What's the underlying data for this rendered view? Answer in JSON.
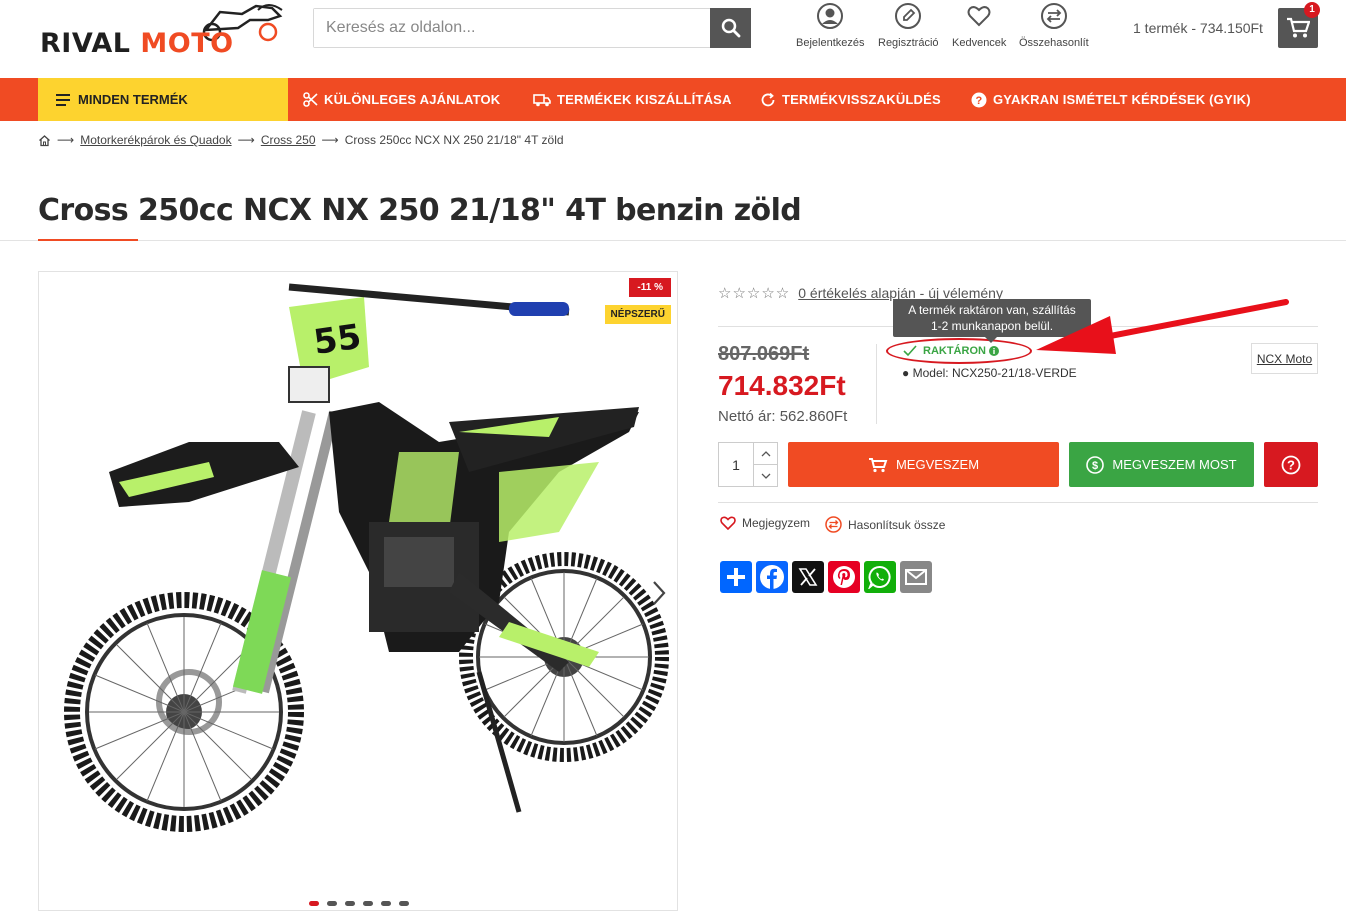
{
  "header": {
    "logo_rival": "RIVAL",
    "logo_moto": "MOTO",
    "search_placeholder": "Keresés az oldalon...",
    "icons": [
      {
        "name": "user-icon",
        "label": "Bejelentkezés"
      },
      {
        "name": "pencil-icon",
        "label": "Regisztráció"
      },
      {
        "name": "heart-icon",
        "label": "Kedvencek"
      },
      {
        "name": "compare-icon",
        "label": "Összehasonlít"
      }
    ],
    "cart_text": "1 termék - 734.150Ft",
    "cart_count": "1"
  },
  "nav": {
    "all_products": "MINDEN TERMÉK",
    "items": [
      "KÜLÖNLEGES AJÁNLATOK",
      "TERMÉKEK KISZÁLLÍTÁSA",
      "TERMÉKVISSZAKÜLDÉS",
      "GYAKRAN ISMÉTELT KÉRDÉSEK (GYIK)"
    ]
  },
  "breadcrumb": {
    "items": [
      "Motorkerékpárok és Quadok",
      "Cross 250"
    ],
    "current": "Cross 250cc NCX NX 250 21/18\" 4T zöld"
  },
  "product": {
    "title": "Cross 250cc NCX NX 250 21/18\" 4T benzin zöld",
    "badge_discount": "-11 %",
    "badge_popular": "NÉPSZERŰ",
    "rating_link": "0 értékelés alapján",
    "rating_sep": " - ",
    "rating_new": "új vélemény",
    "old_price": "807.069Ft",
    "price": "714.832Ft",
    "net_price": "Nettó ár: 562.860Ft",
    "stock": "RAKTÁRON",
    "tooltip_line1": "A termék raktáron van, szállítás",
    "tooltip_line2": "1-2 munkanapon belül.",
    "model": "Model: NCX250-21/18-VERDE",
    "brand": "NCX Moto",
    "quantity": "1",
    "buy_label": "MEGVESZEM",
    "buy_now_label": "MEGVESZEM MOST",
    "wishlist_label": "Megjegyzem",
    "compare_label": "Hasonlítsuk össze",
    "gallery_dots": 6,
    "active_dot": 0
  },
  "share": [
    "share-plus-icon",
    "facebook-icon",
    "x-icon",
    "pinterest-icon",
    "whatsapp-icon",
    "email-icon"
  ],
  "colors": {
    "accent": "#f04b23",
    "yellow": "#fdd32f",
    "red": "#d71920",
    "green": "#3aa544",
    "dark": "#555555"
  }
}
